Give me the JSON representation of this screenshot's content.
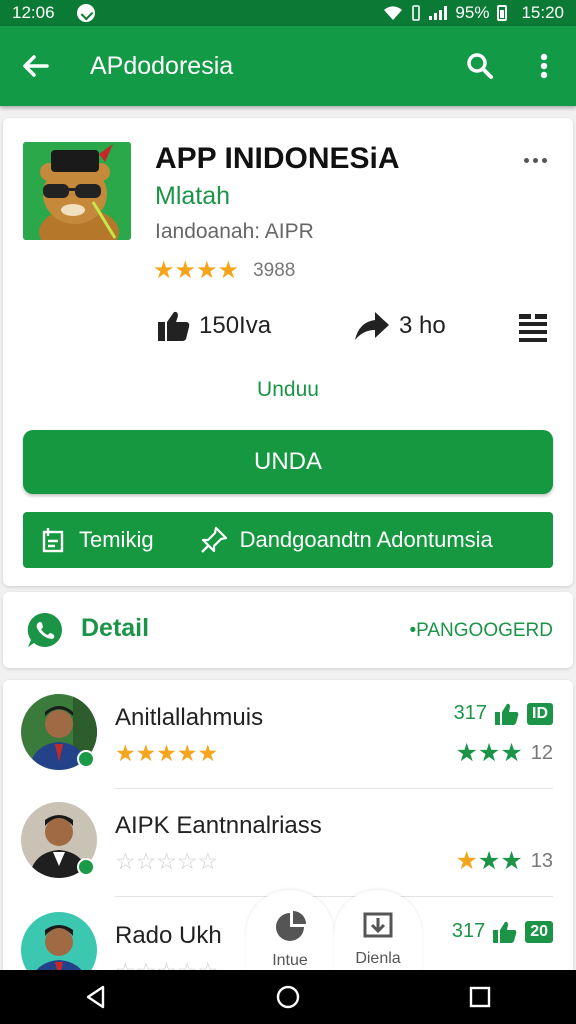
{
  "status_bar": {
    "time_left": "12:06",
    "battery_text": "95%",
    "time_right": "15:20"
  },
  "toolbar": {
    "title": "APdodoresia"
  },
  "app": {
    "name": "APP INIDONESiA",
    "developer": "Mlatah",
    "subtitle": "Iandoanah: AIPR",
    "rating_count": "3988",
    "stars": "★★★★",
    "likes": "150Iva",
    "shares": "3 ho",
    "download_link": "Unduu",
    "install_label": "UNDA",
    "action_left": "Temikig",
    "action_right": "Dandgoandtn Adontumsia"
  },
  "detail": {
    "title": "Detail",
    "link": "•PANGOOGERD"
  },
  "reviews": [
    {
      "name": "Anitlallahmuis",
      "stars": "★★★★★",
      "meta_count": "317",
      "tag": "ID",
      "gstars": "★★★",
      "gcount": "12",
      "avatar_bg": "#3a7a3a"
    },
    {
      "name": "AIPK Eantnnalriass",
      "stars": "☆☆☆☆☆",
      "gstars_gold": "★",
      "gstars": "★★",
      "gcount": "13",
      "avatar_bg": "#c9c2b5"
    },
    {
      "name": "Rado Ukh",
      "stars": "☆☆☆☆☆",
      "meta_count": "317",
      "tag": "20",
      "avatar_bg": "#3cc7b0"
    }
  ],
  "bottom_tabs": [
    {
      "label": "Intue"
    },
    {
      "label": "Dienla"
    }
  ],
  "colors": {
    "primary": "#129a46",
    "status_bar": "#0a7a35",
    "star": "#f4a51c"
  }
}
